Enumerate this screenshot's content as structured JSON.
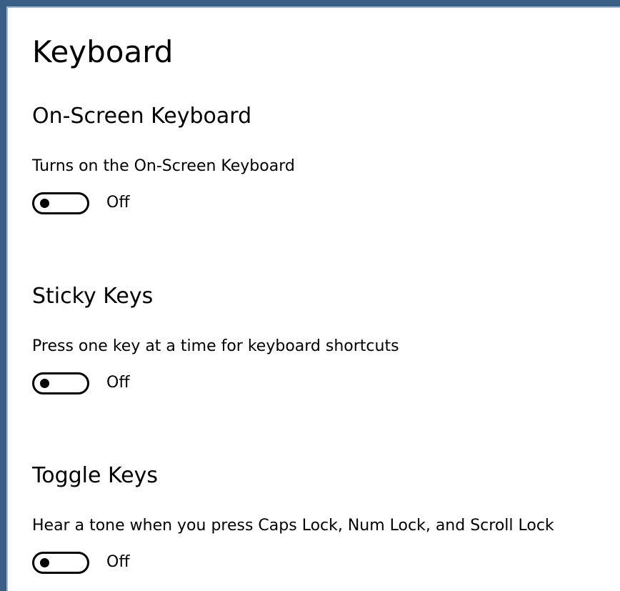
{
  "page": {
    "title": "Keyboard"
  },
  "sections": [
    {
      "heading": "On-Screen Keyboard",
      "description": "Turns on the On-Screen Keyboard",
      "toggle_state": "Off",
      "toggle_on": false
    },
    {
      "heading": "Sticky Keys",
      "description": "Press one key at a time for keyboard shortcuts",
      "toggle_state": "Off",
      "toggle_on": false
    },
    {
      "heading": "Toggle Keys",
      "description": "Hear a tone when you press Caps Lock, Num Lock, and Scroll Lock",
      "toggle_state": "Off",
      "toggle_on": false
    }
  ],
  "colors": {
    "frame_border": "#3a5f86",
    "background": "#ffffff",
    "text": "#000000"
  }
}
